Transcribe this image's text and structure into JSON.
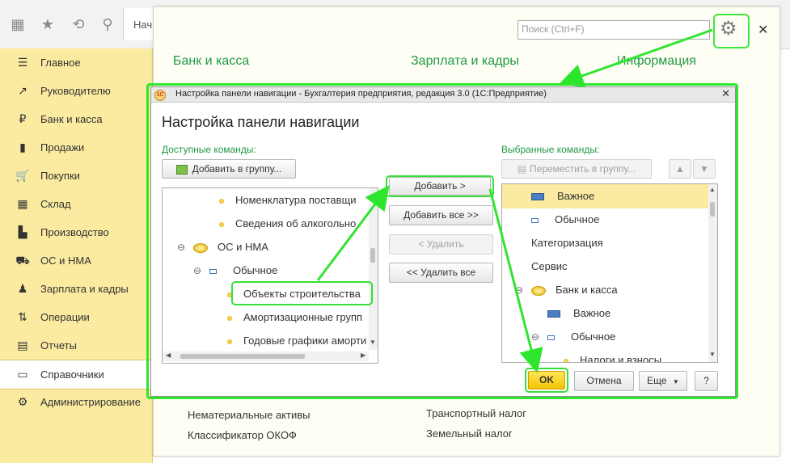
{
  "toolbar": {
    "search_fragment": "Нач"
  },
  "sidebar": {
    "items": [
      {
        "label": "Главное",
        "icon": "menu-lines-icon"
      },
      {
        "label": "Руководителю",
        "icon": "trend-icon"
      },
      {
        "label": "Банк и касса",
        "icon": "ruble-coin-icon"
      },
      {
        "label": "Продажи",
        "icon": "shopping-bag-icon"
      },
      {
        "label": "Покупки",
        "icon": "cart-icon"
      },
      {
        "label": "Склад",
        "icon": "warehouse-grid-icon"
      },
      {
        "label": "Производство",
        "icon": "factory-icon"
      },
      {
        "label": "ОС и НМА",
        "icon": "truck-icon"
      },
      {
        "label": "Зарплата и кадры",
        "icon": "person-icon"
      },
      {
        "label": "Операции",
        "icon": "debit-credit-icon"
      },
      {
        "label": "Отчеты",
        "icon": "bar-report-icon"
      },
      {
        "label": "Справочники",
        "icon": "book-icon"
      },
      {
        "label": "Администрирование",
        "icon": "gear-icon"
      }
    ]
  },
  "main": {
    "search_placeholder": "Поиск (Ctrl+F)",
    "sections": [
      "Банк и касса",
      "Зарплата и кадры",
      "Информация"
    ],
    "bottom_links_left": [
      "Нематериальные активы",
      "Классификатор ОКОФ"
    ],
    "bottom_links_right": [
      "Транспортный налог",
      "Земельный налог"
    ]
  },
  "dialog": {
    "window_title": "Настройка панели навигации - Бухгалтерия предприятия, редакция 3.0  (1С:Предприятие)",
    "logo_text": "1С",
    "heading": "Настройка панели навигации",
    "available_label": "Доступные команды:",
    "selected_label": "Выбранные команды:",
    "add_to_group": "Добавить в группу...",
    "move_to_group": "Переместить в группу...",
    "available_items": [
      {
        "label": "Номенклатура поставщи",
        "type": "dot"
      },
      {
        "label": "Сведения об алкогольно",
        "type": "dot"
      },
      {
        "label": "ОС и НМА",
        "type": "folder"
      },
      {
        "label": "Обычное",
        "type": "small-blue"
      },
      {
        "label": "Объекты строительства",
        "type": "dot"
      },
      {
        "label": "Амортизационные групп",
        "type": "dot"
      },
      {
        "label": "Годовые графики аморти",
        "type": "dot"
      }
    ],
    "selected_items": [
      {
        "label": "Важное",
        "type": "large-blue"
      },
      {
        "label": "Обычное",
        "type": "small-blue"
      },
      {
        "label": "Категоризация",
        "type": "none"
      },
      {
        "label": "Сервис",
        "type": "none"
      },
      {
        "label": "Банк и касса",
        "type": "folder"
      },
      {
        "label": "Важное",
        "type": "large-blue"
      },
      {
        "label": "Обычное",
        "type": "small-blue"
      },
      {
        "label": "Налоги и взносы",
        "type": "dot"
      }
    ],
    "buttons": {
      "add": "Добавить >",
      "add_all": "Добавить все >>",
      "remove": "< Удалить",
      "remove_all": "<< Удалить все",
      "ok": "OK",
      "cancel": "Отмена",
      "more": "Еще",
      "help": "?"
    }
  },
  "colors": {
    "sidebar_bg": "#fbeba0",
    "accent_green": "#1f9a44",
    "highlight_green": "#36e036",
    "ok_yellow": "#f7d21a",
    "selected_row": "#fbeba0"
  }
}
